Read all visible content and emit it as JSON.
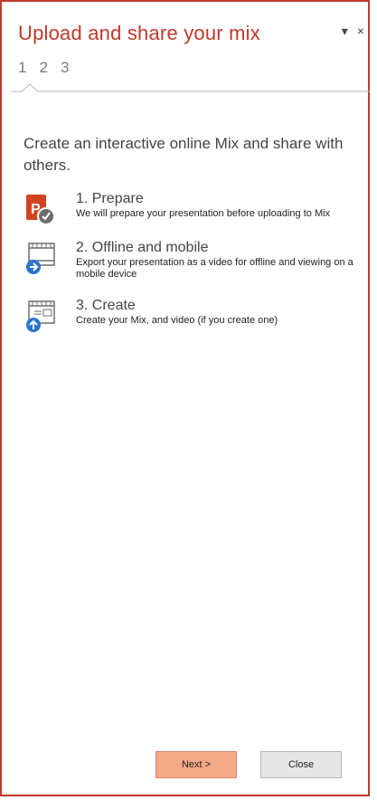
{
  "pane": {
    "title": "Upload and share your mix",
    "dropdown_glyph": "▾",
    "close_glyph": "×",
    "steps": [
      "1",
      "2",
      "3"
    ]
  },
  "intro": "Create an interactive online Mix and share with others.",
  "items": [
    {
      "title": "1. Prepare",
      "desc": "We will prepare your presentation before uploading to Mix",
      "icon": "powerpoint-check-icon"
    },
    {
      "title": "2. Offline and mobile",
      "desc": "Export your presentation as a video for offline and viewing on a mobile device",
      "icon": "video-export-icon"
    },
    {
      "title": "3. Create",
      "desc": "Create your Mix, and video (if you create one)",
      "icon": "upload-mix-icon"
    }
  ],
  "buttons": {
    "next": "Next >",
    "close": "Close"
  },
  "colors": {
    "accent": "#c0392b",
    "next_bg": "#f4a988",
    "close_bg": "#e6e6e6"
  }
}
